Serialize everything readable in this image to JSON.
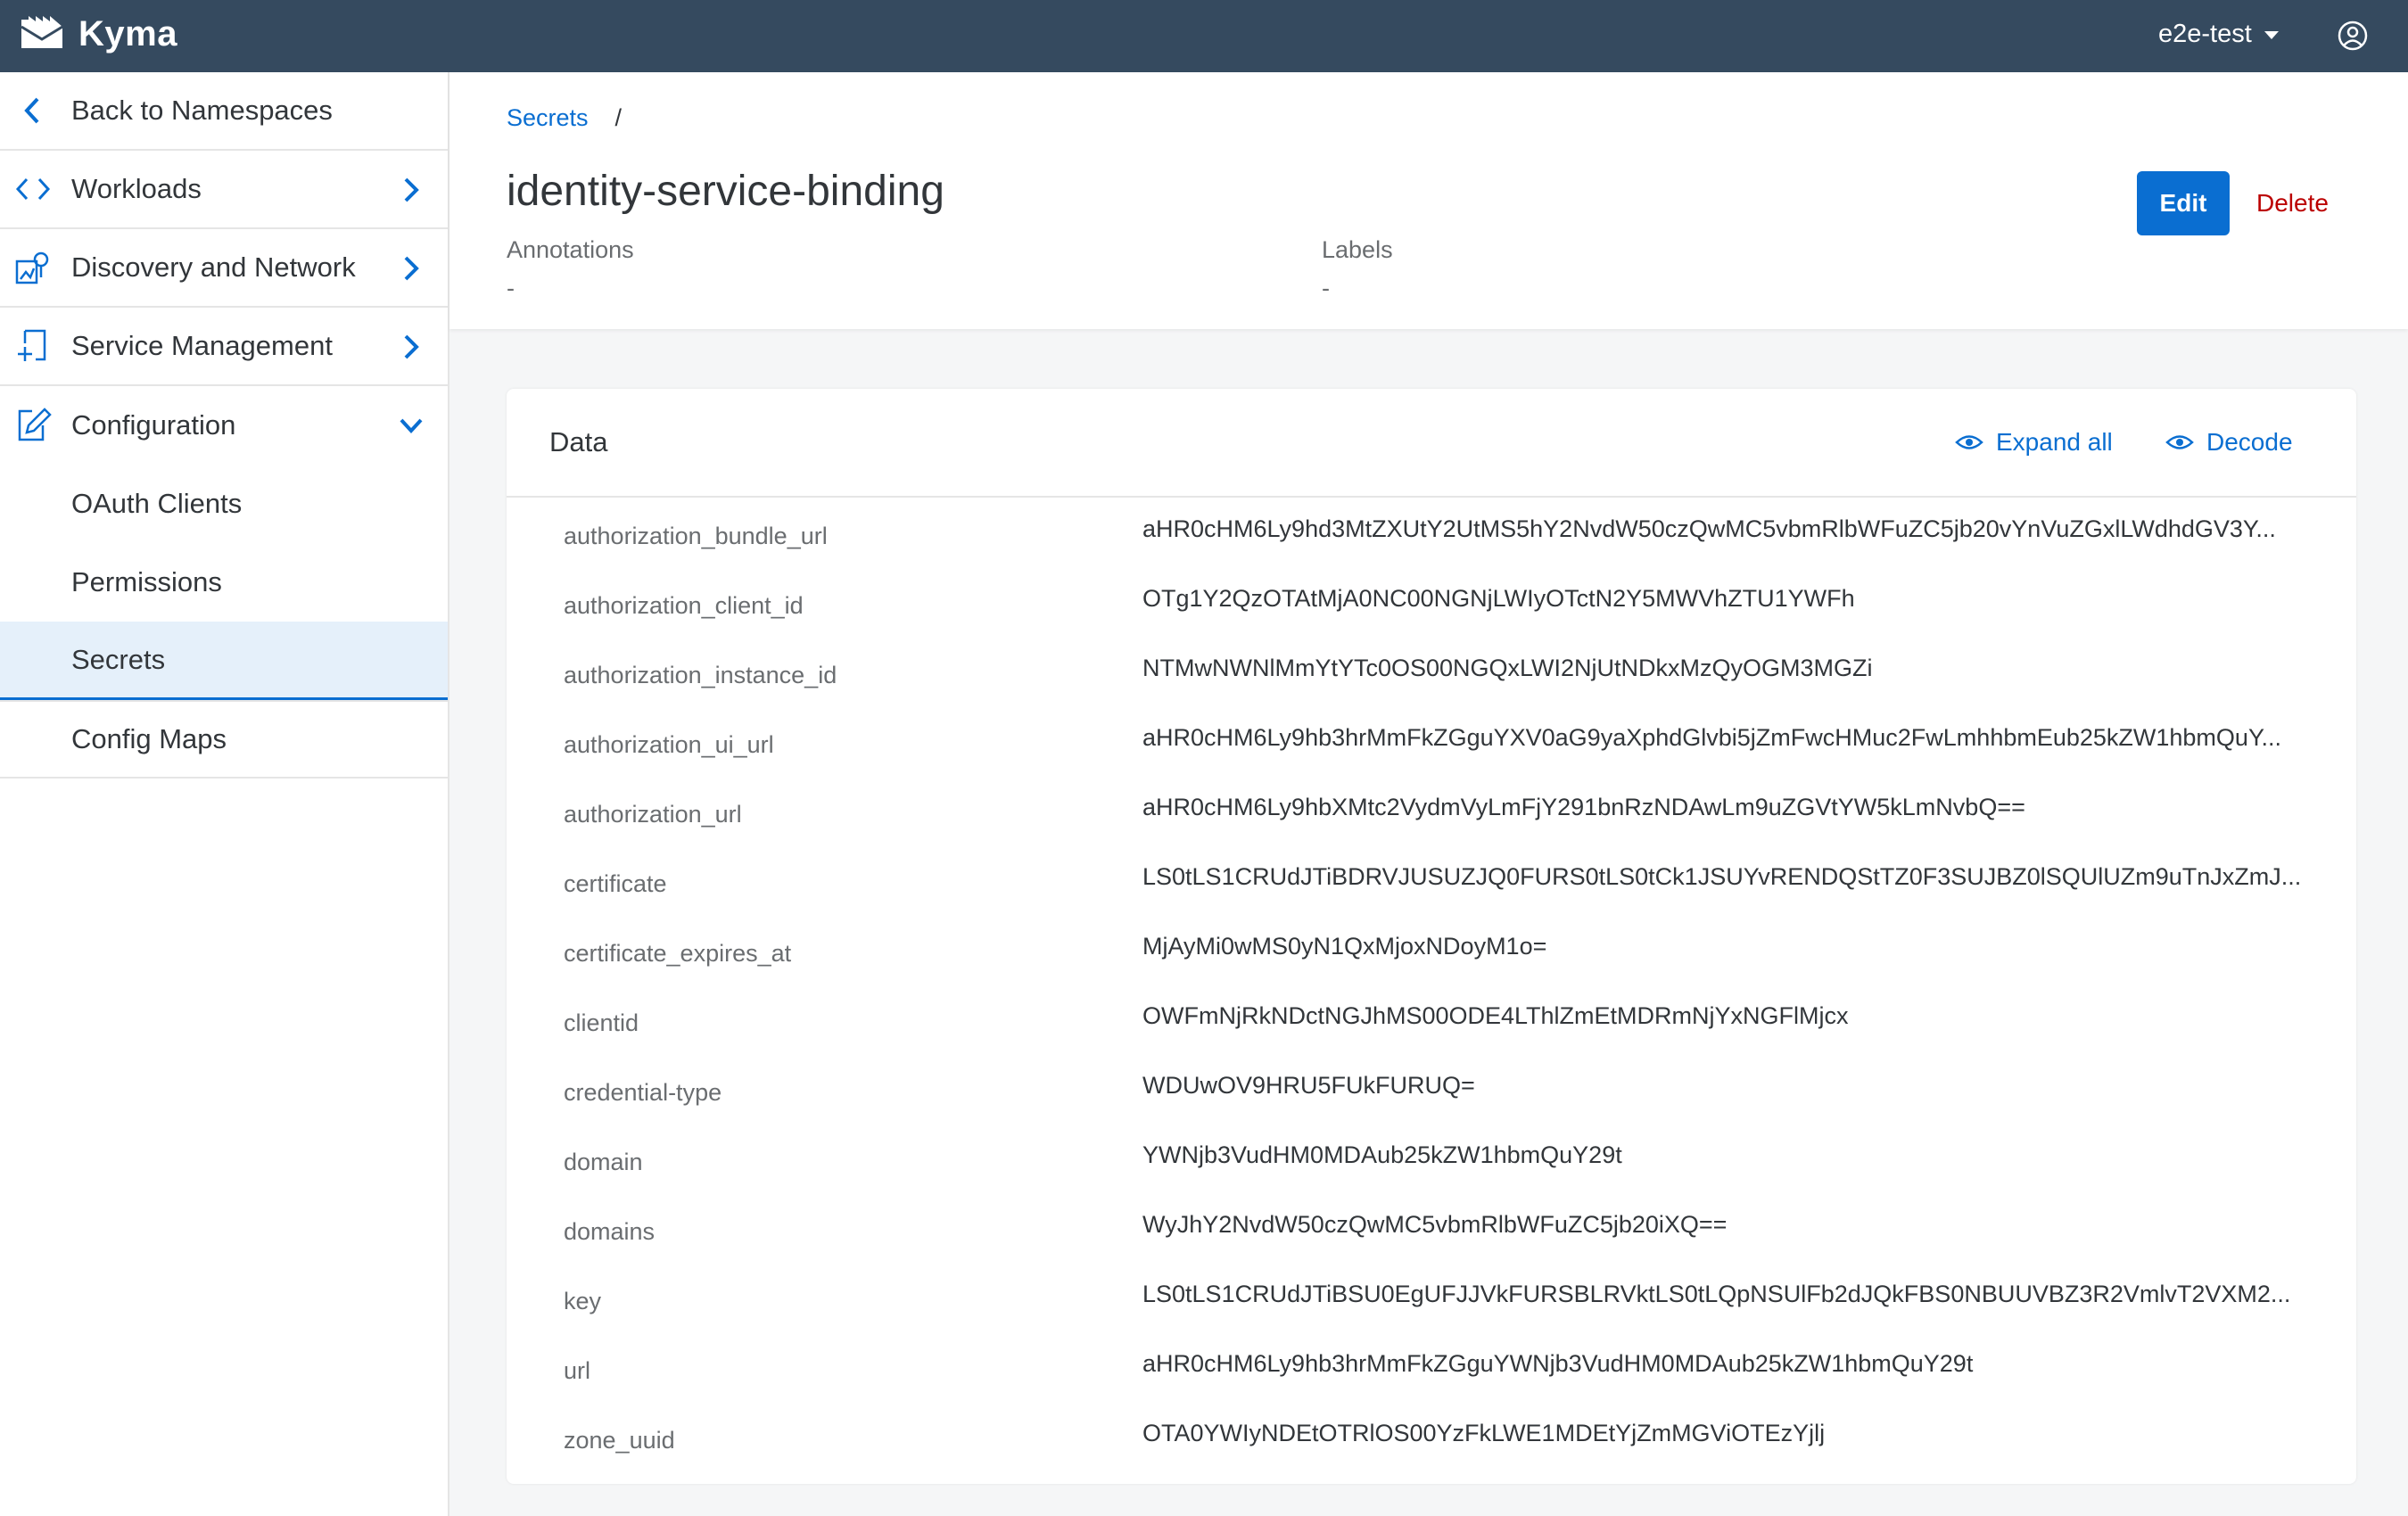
{
  "shellbar": {
    "brand": "Kyma",
    "namespace": "e2e-test"
  },
  "sidebar": {
    "back": "Back to Namespaces",
    "items": [
      {
        "label": "Workloads"
      },
      {
        "label": "Discovery and Network"
      },
      {
        "label": "Service Management"
      },
      {
        "label": "Configuration"
      }
    ],
    "subitems": [
      {
        "label": "OAuth Clients"
      },
      {
        "label": "Permissions"
      },
      {
        "label": "Secrets"
      },
      {
        "label": "Config Maps"
      }
    ]
  },
  "header": {
    "breadcrumb": "Secrets",
    "breadcrumb_sep": "/",
    "title": "identity-service-binding",
    "annotations_label": "Annotations",
    "annotations_value": "-",
    "labels_label": "Labels",
    "labels_value": "-",
    "edit_label": "Edit",
    "delete_label": "Delete"
  },
  "data_panel": {
    "title": "Data",
    "expand_all": "Expand all",
    "decode": "Decode",
    "rows": [
      {
        "key": "authorization_bundle_url",
        "value": "aHR0cHM6Ly9hd3MtZXUtY2UtMS5hY2NvdW50czQwMC5vbmRlbWFuZC5jb20vYnVuZGxlLWdhdGV3Y..."
      },
      {
        "key": "authorization_client_id",
        "value": "OTg1Y2QzOTAtMjA0NC00NGNjLWIyOTctN2Y5MWVhZTU1YWFh"
      },
      {
        "key": "authorization_instance_id",
        "value": "NTMwNWNlMmYtYTc0OS00NGQxLWI2NjUtNDkxMzQyOGM3MGZi"
      },
      {
        "key": "authorization_ui_url",
        "value": "aHR0cHM6Ly9hb3hrMmFkZGguYXV0aG9yaXphdGlvbi5jZmFwcHMuc2FwLmhhbmEub25kZW1hbmQuY..."
      },
      {
        "key": "authorization_url",
        "value": "aHR0cHM6Ly9hbXMtc2VydmVyLmFjY291bnRzNDAwLm9uZGVtYW5kLmNvbQ=="
      },
      {
        "key": "certificate",
        "value": "LS0tLS1CRUdJTiBDRVJUSUZJQ0FURS0tLS0tCk1JSUYvRENDQStTZ0F3SUJBZ0lSQUlUZm9uTnJxZmJ..."
      },
      {
        "key": "certificate_expires_at",
        "value": "MjAyMi0wMS0yN1QxMjoxNDoyM1o="
      },
      {
        "key": "clientid",
        "value": "OWFmNjRkNDctNGJhMS00ODE4LThlZmEtMDRmNjYxNGFlMjcx"
      },
      {
        "key": "credential-type",
        "value": "WDUwOV9HRU5FUkFURUQ="
      },
      {
        "key": "domain",
        "value": "YWNjb3VudHM0MDAub25kZW1hbmQuY29t"
      },
      {
        "key": "domains",
        "value": "WyJhY2NvdW50czQwMC5vbmRlbWFuZC5jb20iXQ=="
      },
      {
        "key": "key",
        "value": "LS0tLS1CRUdJTiBSU0EgUFJJVkFURSBLRVktLS0tLQpNSUlFb2dJQkFBS0NBUUVBZ3R2VmlvT2VXM2..."
      },
      {
        "key": "url",
        "value": "aHR0cHM6Ly9hb3hrMmFkZGguYWNjb3VudHM0MDAub25kZW1hbmQuY29t"
      },
      {
        "key": "zone_uuid",
        "value": "OTA0YWIyNDEtOTRlOS00YzFkLWE1MDEtYjZmMGViOTEzYjlj"
      }
    ]
  },
  "colors": {
    "shellbar": "#354a5f",
    "accent": "#0a6ed1",
    "delete": "#bb0000",
    "active_bg": "#e5f0fa"
  },
  "icons": {
    "logo": "kyma-logo-icon",
    "user": "user-circle-icon",
    "back": "chevron-left-icon",
    "workloads": "code-brackets-icon",
    "discovery": "network-icon",
    "service": "service-management-icon",
    "configuration": "edit-document-icon",
    "eye": "eye-icon"
  }
}
